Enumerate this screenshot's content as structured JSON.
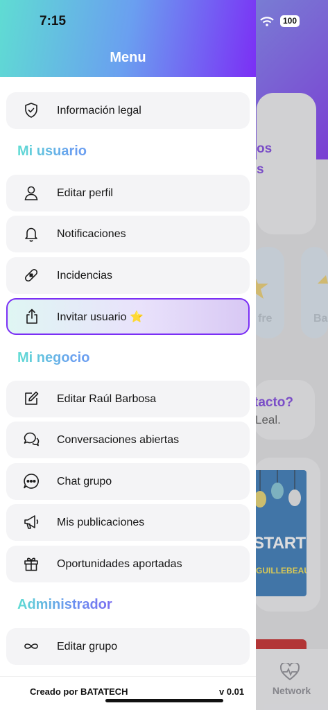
{
  "status_bar": {
    "time": "7:15",
    "battery": "100"
  },
  "drawer": {
    "title": "Menu",
    "top_items": [
      {
        "label": "Información legal",
        "icon": "shield-check-icon"
      }
    ],
    "sections": [
      {
        "title": "Mi usuario",
        "items": [
          {
            "label": "Editar perfil",
            "icon": "user-icon"
          },
          {
            "label": "Notificaciones",
            "icon": "bell-icon"
          },
          {
            "label": "Incidencias",
            "icon": "bandage-icon"
          },
          {
            "label": "Invitar usuario ⭐",
            "icon": "share-icon",
            "highlighted": true
          }
        ]
      },
      {
        "title": "Mi negocio",
        "items": [
          {
            "label": "Editar Raúl Barbosa",
            "icon": "edit-icon"
          },
          {
            "label": "Conversaciones abiertas",
            "icon": "chat-bubbles-icon"
          },
          {
            "label": "Chat grupo",
            "icon": "chat-dots-icon"
          },
          {
            "label": "Mis publicaciones",
            "icon": "megaphone-icon"
          },
          {
            "label": "Oportunidades aportadas",
            "icon": "gift-icon"
          }
        ]
      },
      {
        "title": "Administrador",
        "items": [
          {
            "label": "Editar grupo",
            "icon": "infinity-icon"
          }
        ]
      }
    ],
    "footer": {
      "credit": "Creado por BATATECH",
      "version": "v 0.01"
    }
  },
  "background": {
    "text_fragments": [
      "os",
      "s",
      "fre",
      "Ba",
      "tacto?",
      "Leal."
    ],
    "book": {
      "title": "STARTUP",
      "author": "GUILLEBEAU"
    },
    "nav": {
      "label": "Network",
      "icon": "heart-pulse-icon"
    }
  },
  "colors": {
    "accent_purple": "#7b2ff5",
    "accent_teal": "#5fdcd3",
    "accent_blue": "#6a9ff0"
  }
}
